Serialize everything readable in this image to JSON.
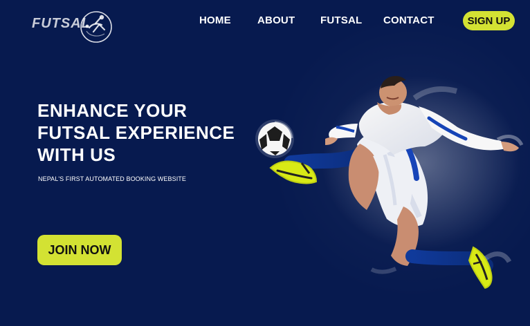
{
  "brand": {
    "logo_text": "FUTSAL"
  },
  "nav": {
    "home": "HOME",
    "about": "ABOUT",
    "futsal": "FUTSAL",
    "contact": "CONTACT",
    "signup": "SIGN UP"
  },
  "hero": {
    "title": "ENHANCE YOUR\nFUTSAL EXPERIENCE\nWITH US",
    "subtitle": "NEPAL'S FIRST AUTOMATED BOOKING WEBSITE",
    "cta": "JOIN NOW"
  },
  "colors": {
    "background": "#071a4f",
    "accent": "#d3e233",
    "text": "#ffffff"
  },
  "icons": {
    "logo_mark": "futsal-player-logo-icon",
    "hero_image": "football-player-kicking-ball"
  }
}
